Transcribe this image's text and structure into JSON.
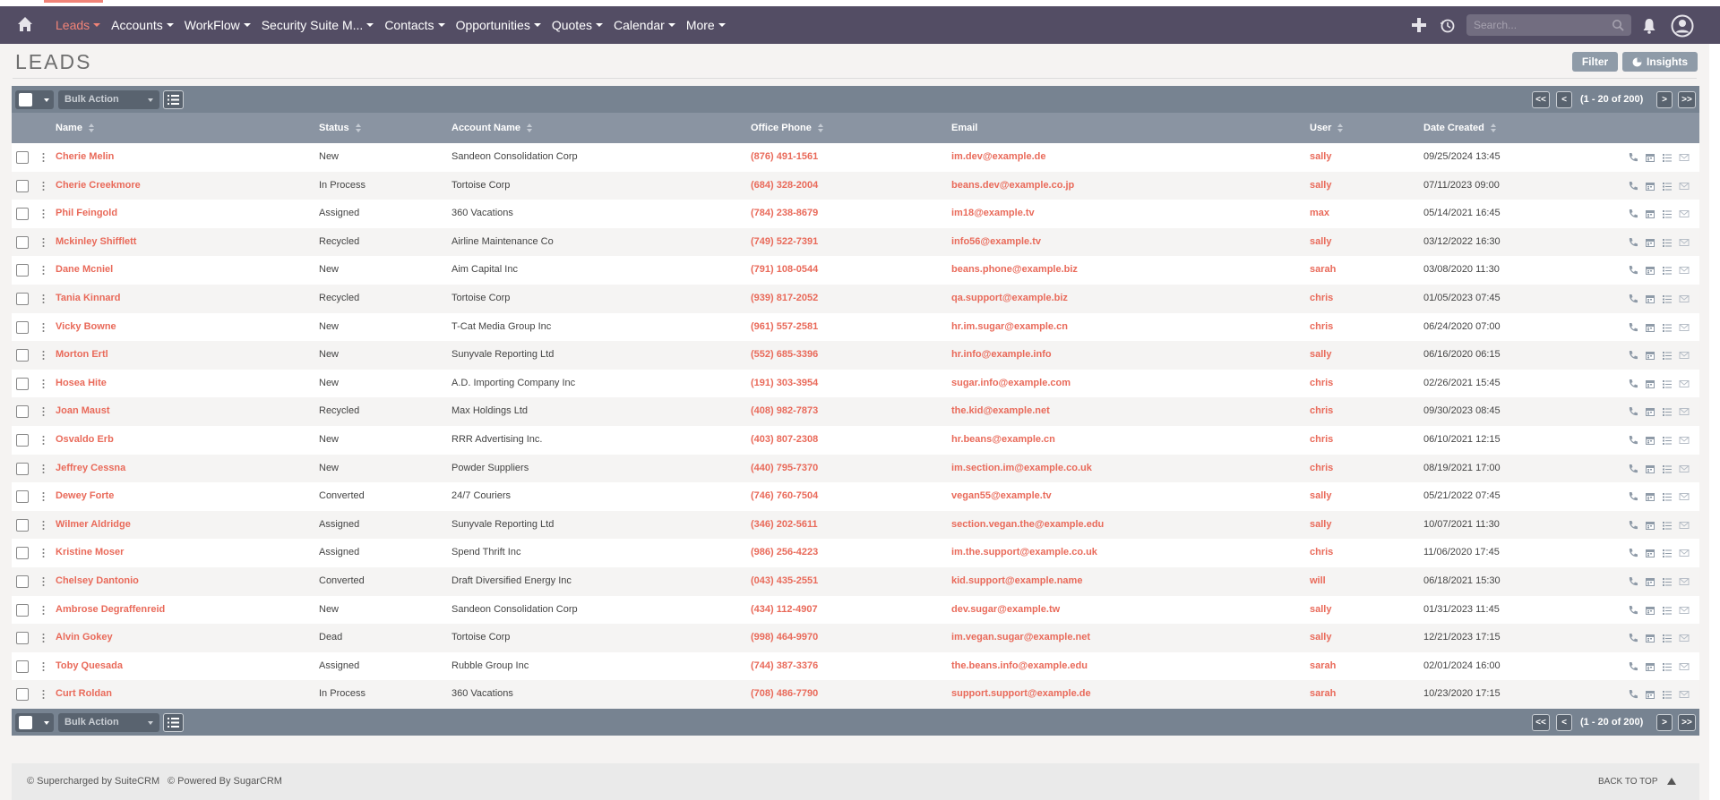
{
  "nav": {
    "menu": [
      {
        "label": "Leads",
        "active": true
      },
      {
        "label": "Accounts",
        "active": false
      },
      {
        "label": "WorkFlow",
        "active": false
      },
      {
        "label": "Security Suite M...",
        "active": false
      },
      {
        "label": "Contacts",
        "active": false
      },
      {
        "label": "Opportunities",
        "active": false
      },
      {
        "label": "Quotes",
        "active": false
      },
      {
        "label": "Calendar",
        "active": false
      },
      {
        "label": "More",
        "active": false
      }
    ],
    "search_placeholder": "Search..."
  },
  "page": {
    "title": "LEADS",
    "filter_label": "Filter",
    "insights_label": "Insights"
  },
  "toolbar": {
    "bulk_action": "Bulk Action",
    "first": "<<",
    "prev": "<",
    "range": "(1 - 20 of 200)",
    "next": ">",
    "last": ">>"
  },
  "columns": {
    "name": "Name",
    "status": "Status",
    "account": "Account Name",
    "phone": "Office Phone",
    "email": "Email",
    "user": "User",
    "date": "Date Created"
  },
  "rows": [
    {
      "name": "Cherie Melin",
      "status": "New",
      "account": "Sandeon Consolidation Corp",
      "phone": "(876) 491-1561",
      "email": "im.dev@example.de",
      "user": "sally",
      "date": "09/25/2024 13:45"
    },
    {
      "name": "Cherie Creekmore",
      "status": "In Process",
      "account": "Tortoise Corp",
      "phone": "(684) 328-2004",
      "email": "beans.dev@example.co.jp",
      "user": "sally",
      "date": "07/11/2023 09:00"
    },
    {
      "name": "Phil Feingold",
      "status": "Assigned",
      "account": "360 Vacations",
      "phone": "(784) 238-8679",
      "email": "im18@example.tv",
      "user": "max",
      "date": "05/14/2021 16:45"
    },
    {
      "name": "Mckinley Shifflett",
      "status": "Recycled",
      "account": "Airline Maintenance Co",
      "phone": "(749) 522-7391",
      "email": "info56@example.tv",
      "user": "sally",
      "date": "03/12/2022 16:30"
    },
    {
      "name": "Dane Mcniel",
      "status": "New",
      "account": "Aim Capital Inc",
      "phone": "(791) 108-0544",
      "email": "beans.phone@example.biz",
      "user": "sarah",
      "date": "03/08/2020 11:30"
    },
    {
      "name": "Tania Kinnard",
      "status": "Recycled",
      "account": "Tortoise Corp",
      "phone": "(939) 817-2052",
      "email": "qa.support@example.biz",
      "user": "chris",
      "date": "01/05/2023 07:45"
    },
    {
      "name": "Vicky Bowne",
      "status": "New",
      "account": "T-Cat Media Group Inc",
      "phone": "(961) 557-2581",
      "email": "hr.im.sugar@example.cn",
      "user": "chris",
      "date": "06/24/2020 07:00"
    },
    {
      "name": "Morton Ertl",
      "status": "New",
      "account": "Sunyvale Reporting Ltd",
      "phone": "(552) 685-3396",
      "email": "hr.info@example.info",
      "user": "sally",
      "date": "06/16/2020 06:15"
    },
    {
      "name": "Hosea Hite",
      "status": "New",
      "account": "A.D. Importing Company Inc",
      "phone": "(191) 303-3954",
      "email": "sugar.info@example.com",
      "user": "chris",
      "date": "02/26/2021 15:45"
    },
    {
      "name": "Joan Maust",
      "status": "Recycled",
      "account": "Max Holdings Ltd",
      "phone": "(408) 982-7873",
      "email": "the.kid@example.net",
      "user": "chris",
      "date": "09/30/2023 08:45"
    },
    {
      "name": "Osvaldo Erb",
      "status": "New",
      "account": "RRR Advertising Inc.",
      "phone": "(403) 807-2308",
      "email": "hr.beans@example.cn",
      "user": "chris",
      "date": "06/10/2021 12:15"
    },
    {
      "name": "Jeffrey Cessna",
      "status": "New",
      "account": "Powder Suppliers",
      "phone": "(440) 795-7370",
      "email": "im.section.im@example.co.uk",
      "user": "chris",
      "date": "08/19/2021 17:00"
    },
    {
      "name": "Dewey Forte",
      "status": "Converted",
      "account": "24/7 Couriers",
      "phone": "(746) 760-7504",
      "email": "vegan55@example.tv",
      "user": "sally",
      "date": "05/21/2022 07:45"
    },
    {
      "name": "Wilmer Aldridge",
      "status": "Assigned",
      "account": "Sunyvale Reporting Ltd",
      "phone": "(346) 202-5611",
      "email": "section.vegan.the@example.edu",
      "user": "sally",
      "date": "10/07/2021 11:30"
    },
    {
      "name": "Kristine Moser",
      "status": "Assigned",
      "account": "Spend Thrift Inc",
      "phone": "(986) 256-4223",
      "email": "im.the.support@example.co.uk",
      "user": "chris",
      "date": "11/06/2020 17:45"
    },
    {
      "name": "Chelsey Dantonio",
      "status": "Converted",
      "account": "Draft Diversified Energy Inc",
      "phone": "(043) 435-2551",
      "email": "kid.support@example.name",
      "user": "will",
      "date": "06/18/2021 15:30"
    },
    {
      "name": "Ambrose Degraffenreid",
      "status": "New",
      "account": "Sandeon Consolidation Corp",
      "phone": "(434) 112-4907",
      "email": "dev.sugar@example.tw",
      "user": "sally",
      "date": "01/31/2023 11:45"
    },
    {
      "name": "Alvin Gokey",
      "status": "Dead",
      "account": "Tortoise Corp",
      "phone": "(998) 464-9970",
      "email": "im.vegan.sugar@example.net",
      "user": "sally",
      "date": "12/21/2023 17:15"
    },
    {
      "name": "Toby Quesada",
      "status": "Assigned",
      "account": "Rubble Group Inc",
      "phone": "(744) 387-3376",
      "email": "the.beans.info@example.edu",
      "user": "sarah",
      "date": "02/01/2024 16:00"
    },
    {
      "name": "Curt Roldan",
      "status": "In Process",
      "account": "360 Vacations",
      "phone": "(708) 486-7790",
      "email": "support.support@example.de",
      "user": "sarah",
      "date": "10/23/2020 17:15"
    }
  ],
  "footer": {
    "supercharged": "© Supercharged by SuiteCRM",
    "powered": "© Powered By SugarCRM",
    "back_to_top": "BACK TO TOP"
  },
  "colors": {
    "nav_bg": "#534d64",
    "accent": "#f08377",
    "link": "#e96a5a",
    "toolbar": "#778391",
    "header_row": "#8a94a2"
  }
}
